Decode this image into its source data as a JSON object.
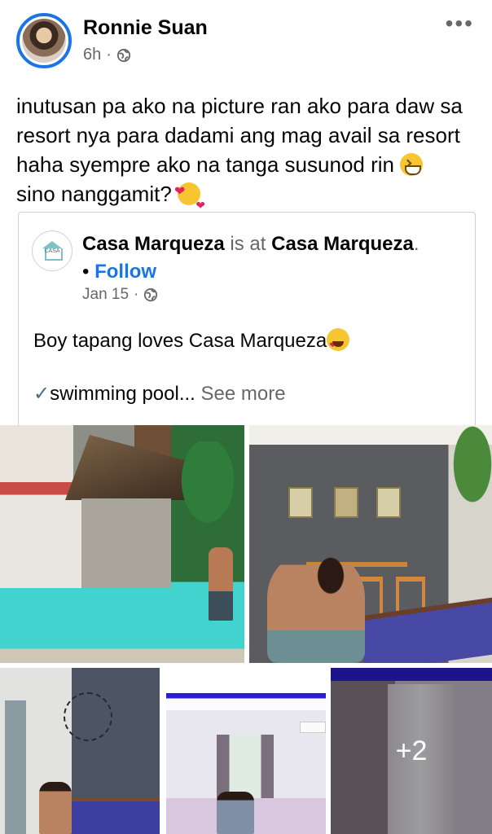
{
  "post": {
    "author": "Ronnie Suan",
    "time": "6h",
    "separator": "·",
    "more_icon": "•••",
    "text_line1": "inutusan pa ako na picture ran ako para daw sa resort nya para dadami ang mag avail sa resort haha syempre ako na tanga susunod rin ",
    "text_line2": "sino nanggamit? "
  },
  "shared": {
    "page_name": "Casa Marqueza",
    "is_at": " is at ",
    "location": "Casa Marqueza",
    "period": ".",
    "bullet": "•",
    "follow_label": "Follow",
    "date": "Jan 15",
    "separator": "·",
    "logo_text": "CASA",
    "text": "Boy tapang loves Casa Marqueza",
    "line2_check": "✓",
    "line2_text": "swimming pool...",
    "see_more": "See more"
  },
  "photos": {
    "more_count": "+2"
  },
  "colors": {
    "accent": "#1b74e4",
    "secondary_text": "#65676b"
  },
  "icons": [
    "globe-icon",
    "more-options-icon",
    "grinning-squinting-face-emoji",
    "smiling-face-with-hearts-emoji",
    "heart-eyes-emoji"
  ]
}
